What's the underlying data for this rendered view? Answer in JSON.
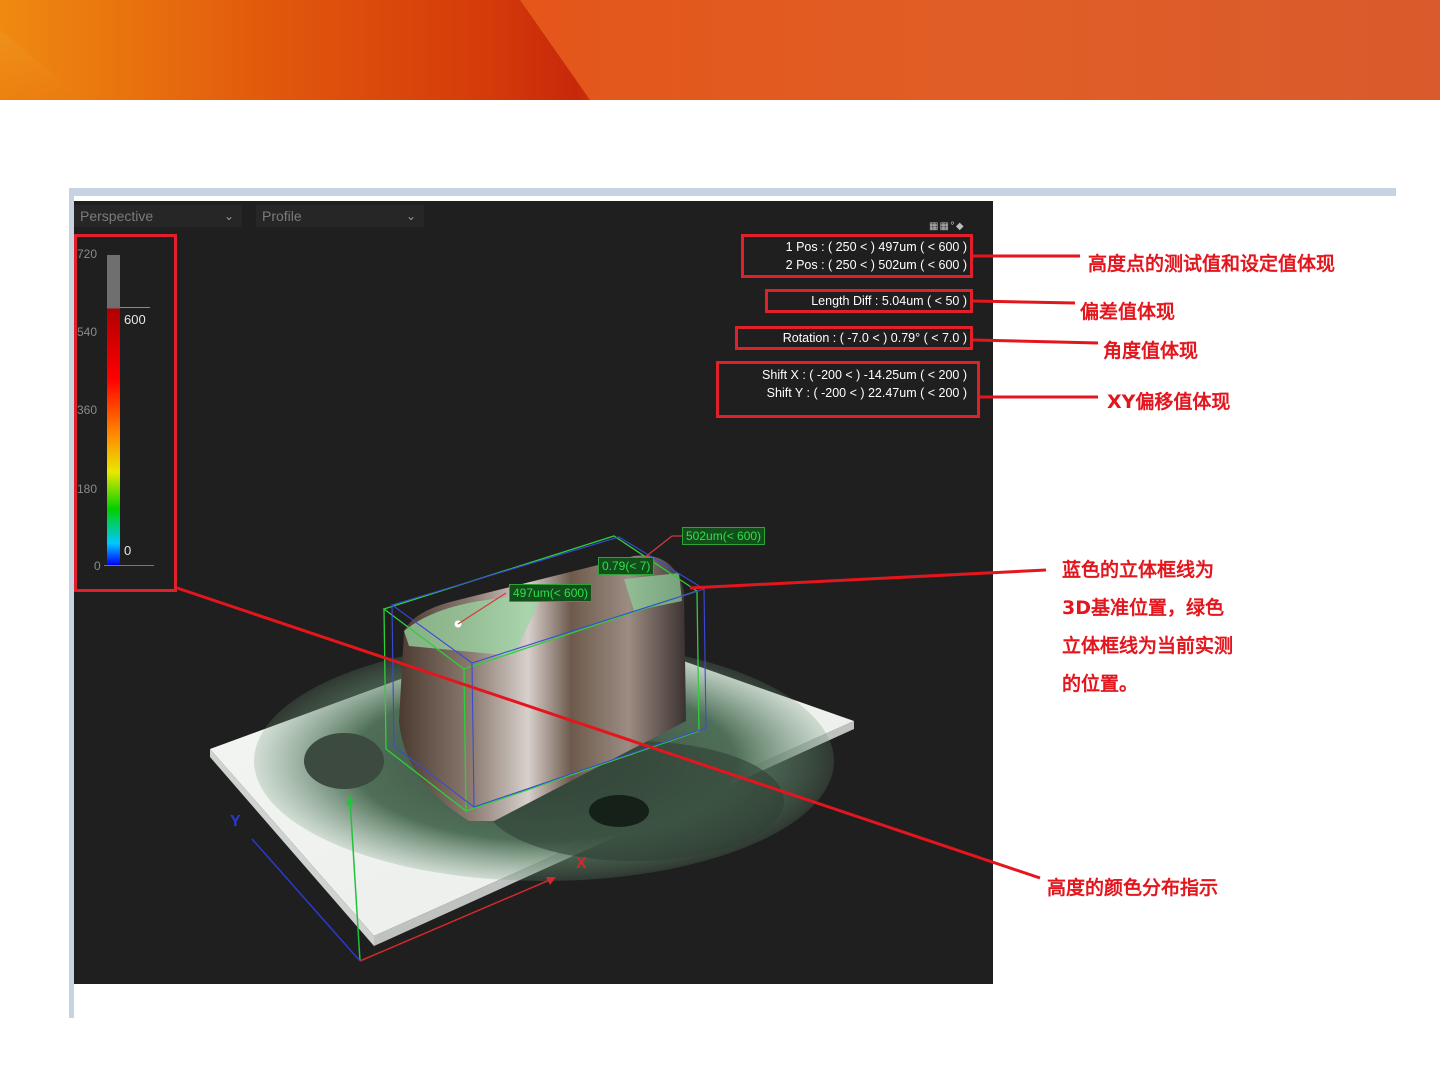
{
  "viewer": {
    "view_mode": "Perspective",
    "profile_mode": "Profile",
    "scale_ticks": [
      "720",
      "540",
      "360",
      "180",
      "0"
    ],
    "scale_upper_value": "600",
    "scale_lower_value": "0",
    "readouts": {
      "pos1": "1 Pos  : ( 250 < ) 497um ( < 600 )",
      "pos2": "2 Pos  : ( 250 < ) 502um ( < 600 )",
      "length_diff": "Length Diff  : 5.04um ( < 50 )",
      "rotation": "Rotation : ( -7.0 < ) 0.79° ( < 7.0 )",
      "shift_x": "Shift X : ( -200 < ) -14.25um ( < 200 )",
      "shift_y": "Shift Y : ( -200 < ) 22.47um ( < 200 )"
    },
    "tags": {
      "point2": "502um(< 600)",
      "angle": "0.79(< 7)",
      "point1": "497um(< 600)"
    },
    "axes": {
      "x": "X",
      "y": "Y"
    }
  },
  "annotations": {
    "height_points": "高度点的测试值和设定值体现",
    "deviation": "偏差值体现",
    "angle": "角度值体现",
    "xy_shift": "XY偏移值体现",
    "box_line1": "蓝色的立体框线为",
    "box_line2": "3D基准位置，绿色",
    "box_line3": "立体框线为当前实测",
    "box_line4": "的位置。",
    "color_distribution": "高度的颜色分布指示"
  },
  "colors": {
    "annotation": "#e3161e",
    "tag_text": "#2fe04a",
    "viewer_bg": "#1f1f1f"
  }
}
